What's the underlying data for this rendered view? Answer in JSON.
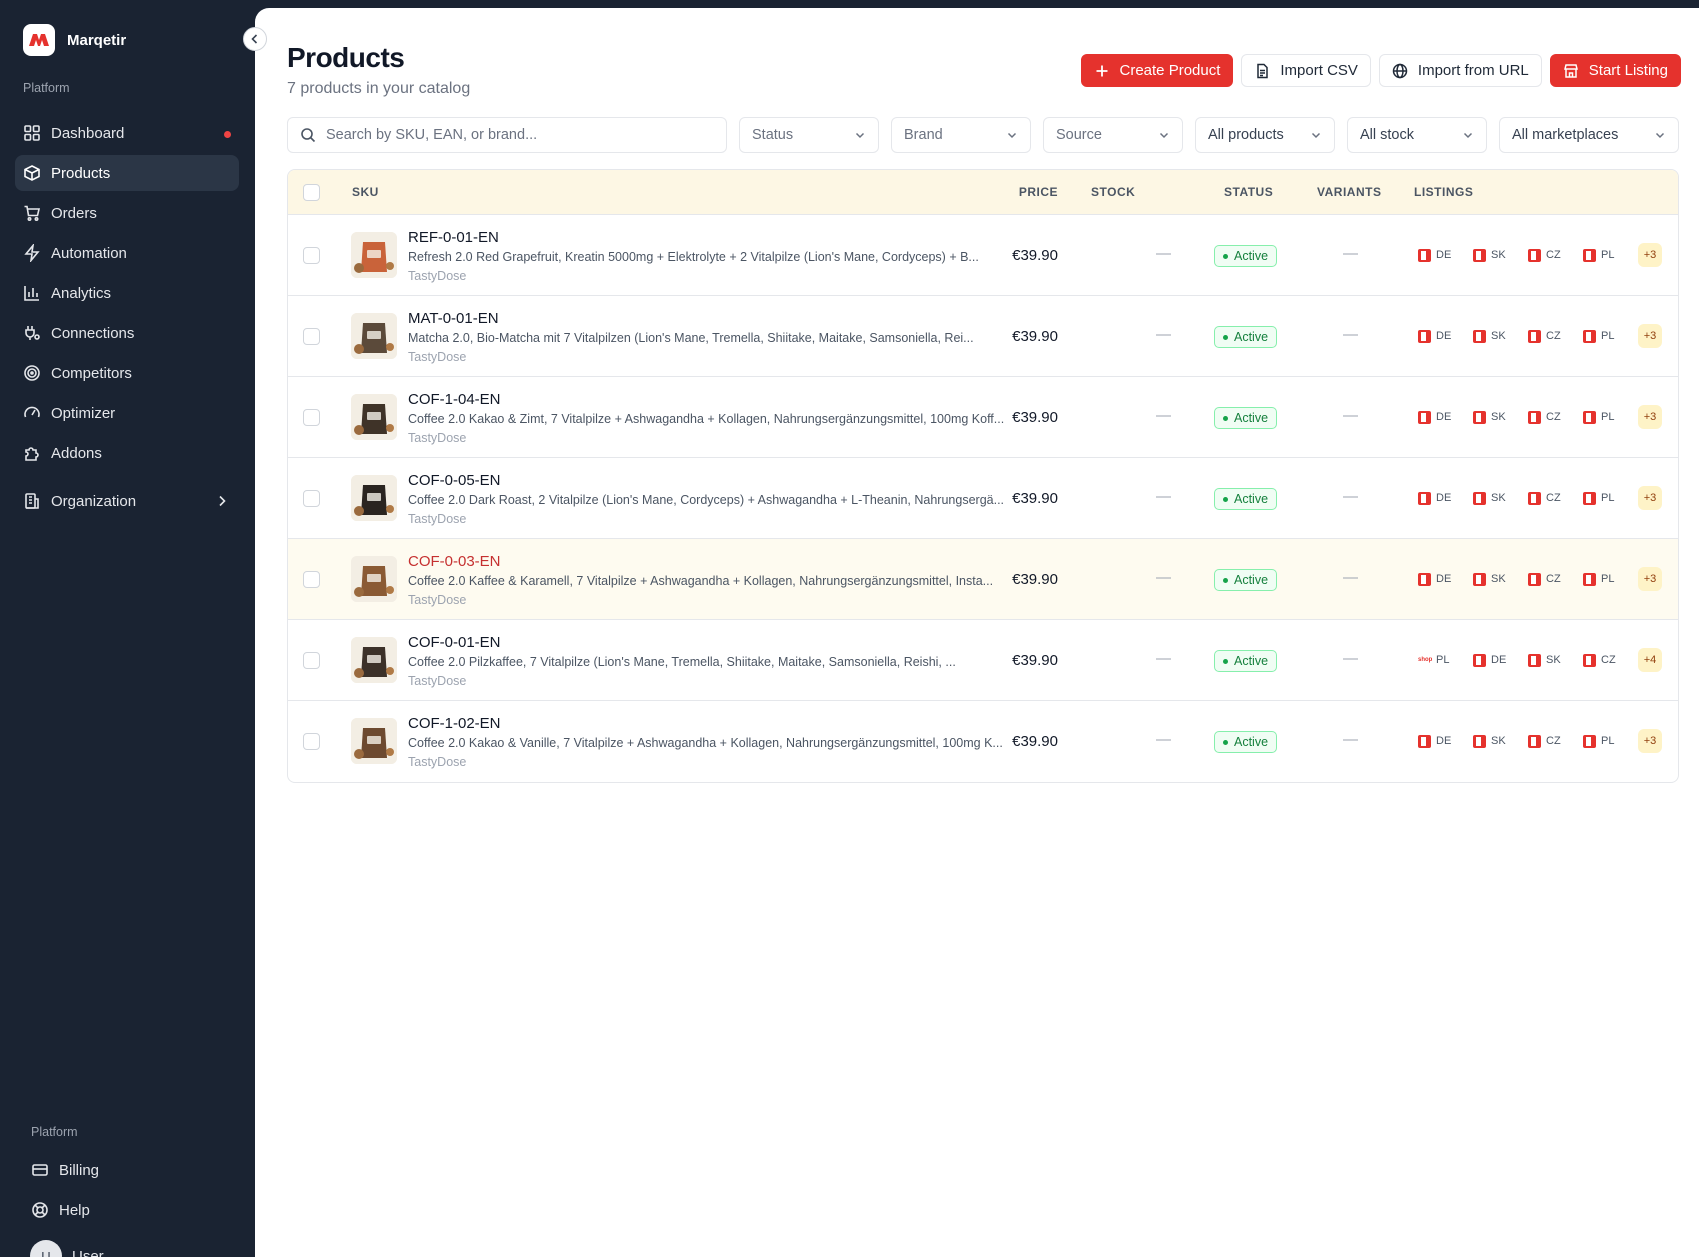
{
  "app": {
    "name": "Marqetir"
  },
  "sidebar": {
    "section_top": "Platform",
    "items": [
      {
        "label": "Dashboard",
        "icon": "dashboard-icon",
        "badge": true
      },
      {
        "label": "Products",
        "icon": "box-icon",
        "active": true
      },
      {
        "label": "Orders",
        "icon": "cart-icon"
      },
      {
        "label": "Automation",
        "icon": "bolt-icon"
      },
      {
        "label": "Analytics",
        "icon": "bar-chart-icon"
      },
      {
        "label": "Connections",
        "icon": "plug-icon"
      },
      {
        "label": "Competitors",
        "icon": "target-icon"
      },
      {
        "label": "Optimizer",
        "icon": "gauge-icon"
      },
      {
        "label": "Addons",
        "icon": "puzzle-icon"
      },
      {
        "label": "Organization",
        "icon": "building-icon"
      }
    ],
    "section_bottom": "Platform",
    "bottom_items": [
      {
        "label": "Billing",
        "icon": "credit-card-icon"
      },
      {
        "label": "Help",
        "icon": "lifebuoy-icon"
      }
    ],
    "user": {
      "initial": "U",
      "name": "User"
    }
  },
  "header": {
    "title": "Products",
    "subtitle": "7 products in your catalog"
  },
  "actions": {
    "create": "Create Product",
    "import_csv": "Import CSV",
    "import_url": "Import from URL",
    "start_listing": "Start Listing"
  },
  "filters": {
    "search_placeholder": "Search by SKU, EAN, or brand...",
    "status": "Status",
    "brand": "Brand",
    "source": "Source",
    "products": "All products",
    "stock": "All stock",
    "marketplaces": "All marketplaces"
  },
  "table": {
    "columns": {
      "sku": "SKU",
      "price": "PRICE",
      "stock": "STOCK",
      "status": "STATUS",
      "variants": "VARIANTS",
      "listings": "LISTINGS"
    },
    "rows": [
      {
        "sku": "REF-0-01-EN",
        "desc": "Refresh 2.0 Red Grapefruit, Kreatin 5000mg + Elektrolyte + 2 Vitalpilze (Lion's Mane, Cordyceps) + B...",
        "brand": "TastyDose",
        "price": "€39.90",
        "stock": "—",
        "status": "Active",
        "variants": "—",
        "listings": [
          "DE",
          "SK",
          "CZ",
          "PL"
        ],
        "more": "+3",
        "thumb_color": "#c9633a"
      },
      {
        "sku": "MAT-0-01-EN",
        "desc": "Matcha 2.0, Bio-Matcha mit 7 Vitalpilzen (Lion's Mane, Tremella, Shiitake, Maitake, Samsoniella, Rei...",
        "brand": "TastyDose",
        "price": "€39.90",
        "stock": "—",
        "status": "Active",
        "variants": "—",
        "listings": [
          "DE",
          "SK",
          "CZ",
          "PL"
        ],
        "more": "+3",
        "thumb_color": "#5b4a3a"
      },
      {
        "sku": "COF-1-04-EN",
        "desc": "Coffee 2.0 Kakao & Zimt, 7 Vitalpilze + Ashwagandha + Kollagen, Nahrungsergänzungsmittel, 100mg Koff...",
        "brand": "TastyDose",
        "price": "€39.90",
        "stock": "—",
        "status": "Active",
        "variants": "—",
        "listings": [
          "DE",
          "SK",
          "CZ",
          "PL"
        ],
        "more": "+3",
        "thumb_color": "#3f3328"
      },
      {
        "sku": "COF-0-05-EN",
        "desc": "Coffee 2.0 Dark Roast, 2 Vitalpilze (Lion's Mane, Cordyceps) + Ashwagandha + L-Theanin, Nahrungsergä...",
        "brand": "TastyDose",
        "price": "€39.90",
        "stock": "—",
        "status": "Active",
        "variants": "—",
        "listings": [
          "DE",
          "SK",
          "CZ",
          "PL"
        ],
        "more": "+3",
        "thumb_color": "#2a2420"
      },
      {
        "sku": "COF-0-03-EN",
        "desc": "Coffee 2.0 Kaffee & Karamell, 7 Vitalpilze + Ashwagandha + Kollagen, Nahrungsergänzungsmittel, Insta...",
        "brand": "TastyDose",
        "price": "€39.90",
        "stock": "—",
        "status": "Active",
        "variants": "—",
        "listings": [
          "DE",
          "SK",
          "CZ",
          "PL"
        ],
        "more": "+3",
        "thumb_color": "#8a5a34",
        "highlight": true
      },
      {
        "sku": "COF-0-01-EN",
        "desc": "Coffee 2.0 Pilzkaffee, 7 Vitalpilze (Lion's Mane, Tremella, Shiitake, Maitake, Samsoniella, Reishi, ...",
        "brand": "TastyDose",
        "price": "€39.90",
        "stock": "—",
        "status": "Active",
        "variants": "—",
        "listings": [
          "PL",
          "DE",
          "SK",
          "CZ"
        ],
        "first_is_shop": true,
        "more": "+4",
        "thumb_color": "#3c3129"
      },
      {
        "sku": "COF-1-02-EN",
        "desc": "Coffee 2.0 Kakao & Vanille, 7 Vitalpilze + Ashwagandha + Kollagen, Nahrungsergänzungsmittel, 100mg K...",
        "brand": "TastyDose",
        "price": "€39.90",
        "stock": "—",
        "status": "Active",
        "variants": "—",
        "listings": [
          "DE",
          "SK",
          "CZ",
          "PL"
        ],
        "more": "+3",
        "thumb_color": "#6d4a30"
      }
    ]
  },
  "colors": {
    "accent": "#e5322d",
    "sidebar": "#1a2332",
    "header_row": "#fdf7e4",
    "active_green": "#15803d"
  }
}
